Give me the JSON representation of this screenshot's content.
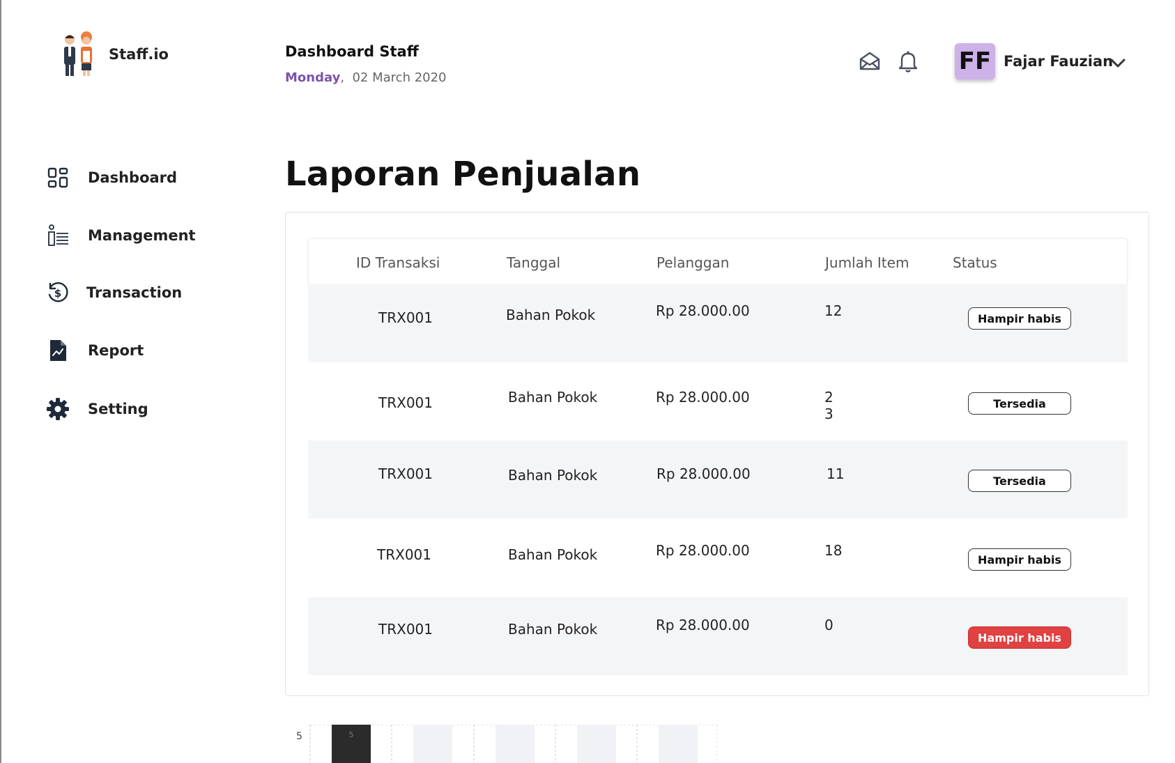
{
  "app": {
    "name": "Staff.io"
  },
  "header": {
    "title": "Dashboard Staff",
    "day": "Monday",
    "date": "02 March 2020",
    "user_initials": "FF",
    "user_name": "Fajar Fauzian"
  },
  "sidebar": {
    "items": [
      {
        "label": "Dashboard",
        "icon": "grid-icon"
      },
      {
        "label": "Management",
        "icon": "list-icon"
      },
      {
        "label": "Transaction",
        "icon": "dollar-history-icon"
      },
      {
        "label": "Report",
        "icon": "report-file-icon"
      },
      {
        "label": "Setting",
        "icon": "gear-icon"
      }
    ]
  },
  "page": {
    "title": "Laporan Penjualan"
  },
  "table": {
    "columns": [
      "ID Transaksi",
      "Tanggal",
      "Pelanggan",
      "Jumlah Item",
      "Status"
    ],
    "rows": [
      {
        "id": "TRX001",
        "tanggal": "Bahan Pokok",
        "pelanggan": "Rp 28.000.00",
        "jumlah": "12",
        "status": "Hampir habis",
        "status_type": "outline"
      },
      {
        "id": "TRX001",
        "tanggal": "Bahan Pokok",
        "pelanggan": "Rp 28.000.00",
        "jumlah": "2\n3",
        "status": "Tersedia",
        "status_type": "outline"
      },
      {
        "id": "TRX001",
        "tanggal": "Bahan Pokok",
        "pelanggan": "Rp 28.000.00",
        "jumlah": "11",
        "status": "Tersedia",
        "status_type": "outline"
      },
      {
        "id": "TRX001",
        "tanggal": "Bahan Pokok",
        "pelanggan": "Rp 28.000.00",
        "jumlah": "18",
        "status": "Hampir habis",
        "status_type": "outline"
      },
      {
        "id": "TRX001",
        "tanggal": "Bahan Pokok",
        "pelanggan": "Rp 28.000.00",
        "jumlah": "0",
        "status": "Hampir habis",
        "status_type": "danger"
      }
    ]
  },
  "chart_data": {
    "type": "bar",
    "y_tick_top": "5",
    "values": [
      5
    ],
    "bar_label": "5"
  },
  "colors": {
    "accent": "#7b52ab",
    "danger": "#e04141",
    "avatar": "#cdb2e8"
  }
}
